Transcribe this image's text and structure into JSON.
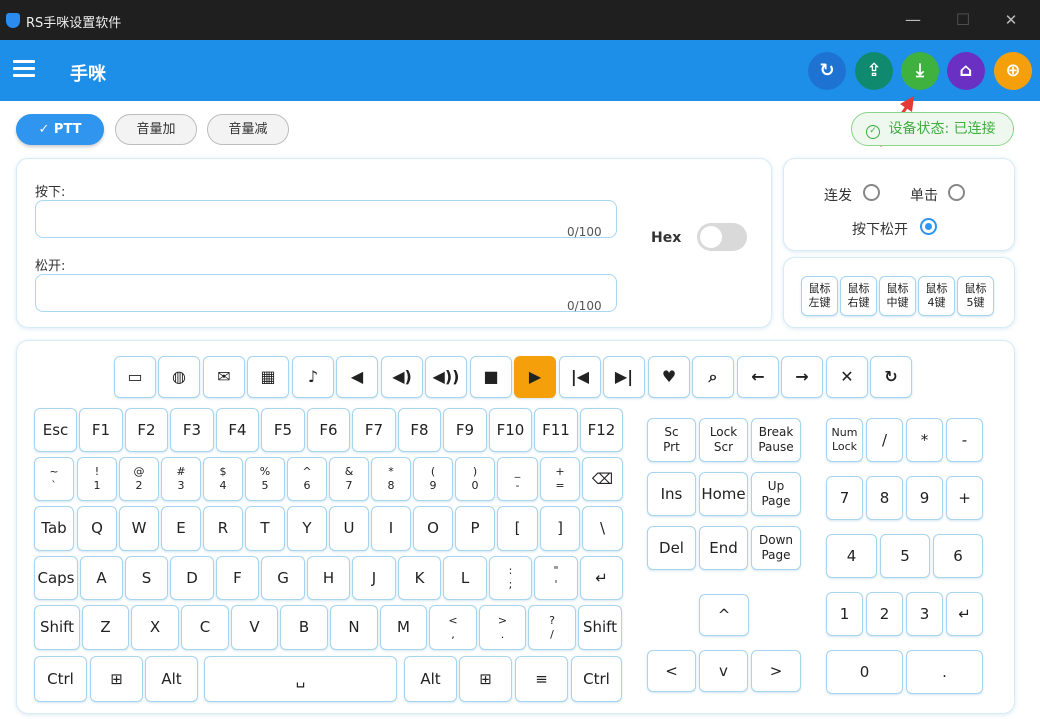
{
  "window": {
    "title": "RS手咪设置软件",
    "minimize": "—",
    "maximize": "☐",
    "close": "✕"
  },
  "appbar": {
    "title": "手咪",
    "buttons": [
      {
        "name": "refresh-icon",
        "glyph": "↻",
        "color": "#1e73d2"
      },
      {
        "name": "upload-icon",
        "glyph": "⇪",
        "color": "#0f8a6e"
      },
      {
        "name": "download-icon",
        "glyph": "⤓",
        "color": "#3fb13f"
      },
      {
        "name": "clean-icon",
        "glyph": "⌂",
        "color": "#6a2fc3"
      },
      {
        "name": "globe-icon",
        "glyph": "⊕",
        "color": "#f5a00a"
      }
    ]
  },
  "tabs": [
    "✓  PTT",
    "音量加",
    "音量减"
  ],
  "status": {
    "text": "设备状态: 已连接",
    "icon": "✓",
    "color": "#3fae3f"
  },
  "editor": {
    "press_label": "按下:",
    "press_counter": "0/100",
    "release_label": "松开:",
    "release_counter": "0/100",
    "hex_label": "Hex"
  },
  "mode": {
    "burst": "连发",
    "single": "单击",
    "press_release": "按下松开",
    "selected": "按下松开"
  },
  "mouse_keys": [
    [
      "鼠标",
      "左键"
    ],
    [
      "鼠标",
      "右键"
    ],
    [
      "鼠标",
      "中键"
    ],
    [
      "鼠标",
      "4键"
    ],
    [
      "鼠标",
      "5键"
    ]
  ],
  "media_keys": [
    {
      "n": "laptop-icon",
      "g": "▭"
    },
    {
      "n": "globe-icon",
      "g": "◍"
    },
    {
      "n": "mail-icon",
      "g": "✉"
    },
    {
      "n": "calculator-icon",
      "g": "▦"
    },
    {
      "n": "music-icon",
      "g": "♪"
    },
    {
      "n": "volume-mute-icon",
      "g": "◀"
    },
    {
      "n": "volume-down-icon",
      "g": "◀)"
    },
    {
      "n": "volume-up-icon",
      "g": "◀))"
    },
    {
      "n": "stop-icon",
      "g": "■"
    },
    {
      "n": "play-icon",
      "g": "▶",
      "active": true
    },
    {
      "n": "previous-icon",
      "g": "|◀"
    },
    {
      "n": "next-icon",
      "g": "▶|"
    },
    {
      "n": "favorite-icon",
      "g": "♥"
    },
    {
      "n": "search-icon",
      "g": "⌕"
    },
    {
      "n": "back-arrow-icon",
      "g": "←"
    },
    {
      "n": "forward-arrow-icon",
      "g": "→"
    },
    {
      "n": "close-icon",
      "g": "✕"
    },
    {
      "n": "reload-icon",
      "g": "↻"
    }
  ],
  "main_keys": [
    [
      "Esc",
      "F1",
      "F2",
      "F3",
      "F4",
      "F5",
      "F6",
      "F7",
      "F8",
      "F9",
      "F10",
      "F11",
      "F12"
    ],
    [
      "~\n`",
      "!\n1",
      "@\n2",
      "#\n3",
      "$\n4",
      "%\n5",
      "^\n6",
      "&\n7",
      "*\n8",
      "(\n9",
      ")\n0",
      "_\n-",
      "+\n=",
      "⌫"
    ],
    [
      "Tab",
      "Q",
      "W",
      "E",
      "R",
      "T",
      "Y",
      "U",
      "I",
      "O",
      "P",
      "[",
      "]",
      "\\"
    ],
    [
      "Caps",
      "A",
      "S",
      "D",
      "F",
      "G",
      "H",
      "J",
      "K",
      "L",
      ":\n;",
      "\"\n'",
      "↵"
    ],
    [
      "Shift",
      "Z",
      "X",
      "C",
      "V",
      "B",
      "N",
      "M",
      "<\n,",
      ">\n.",
      "?\n/",
      "Shift"
    ],
    [
      "Ctrl",
      "⊞",
      "Alt",
      "␣",
      "Alt",
      "⊞",
      "≡",
      "Ctrl"
    ]
  ],
  "nav_keys": [
    [
      "Sc\nPrt",
      "Lock\nScr",
      "Break\nPause"
    ],
    [
      "Ins",
      "Home",
      "Up\nPage"
    ],
    [
      "Del",
      "End",
      "Down\nPage"
    ],
    [
      "^"
    ],
    [
      "<",
      "v",
      ">"
    ]
  ],
  "numpad_keys": [
    [
      "Num\nLock",
      "/",
      "*",
      "-"
    ],
    [
      "7",
      "8",
      "9",
      "+"
    ],
    [
      "4",
      "5",
      "6"
    ],
    [
      "1",
      "2",
      "3",
      "↵"
    ],
    [
      "0",
      "."
    ]
  ]
}
